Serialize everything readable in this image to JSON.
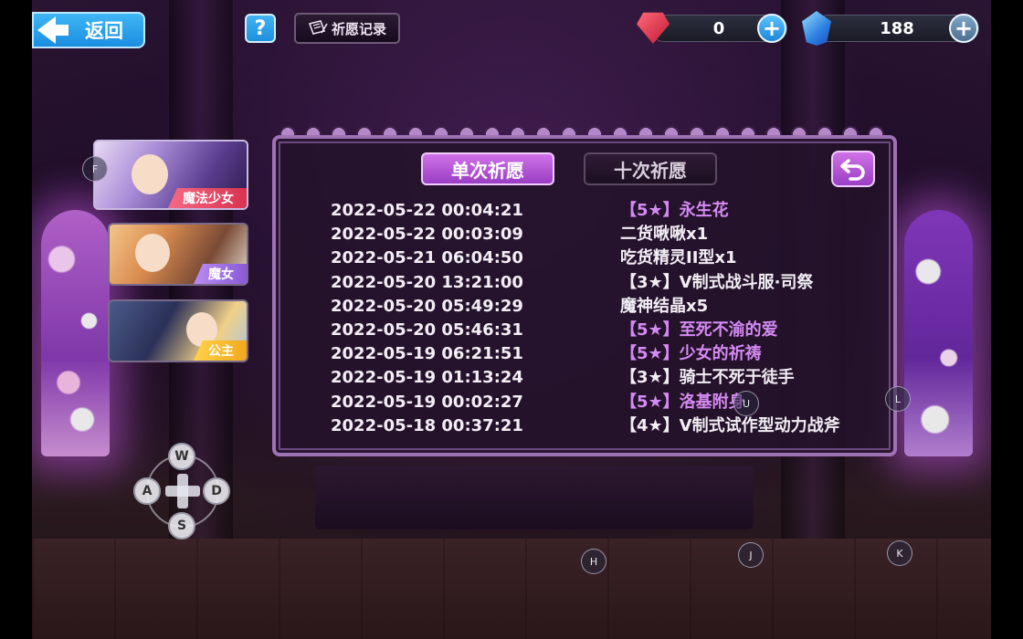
{
  "header": {
    "back_label": "返回",
    "help_label": "?",
    "record_label": "祈愿记录"
  },
  "currency": {
    "red_gem_amount": "0",
    "blue_crystal_amount": "188",
    "plus_label": "+"
  },
  "banners": [
    {
      "label": "魔法少女",
      "color": "#e43f5c"
    },
    {
      "label": "魔女",
      "color": "#a372e6"
    },
    {
      "label": "公主",
      "color": "#f5b82e"
    }
  ],
  "panel": {
    "tab_single": "单次祈愿",
    "tab_ten": "十次祈愿",
    "accent_color": "#d58af2",
    "records": [
      {
        "time": "2022-05-22 00:04:21",
        "item": "【5★】永生花",
        "rare": true
      },
      {
        "time": "2022-05-22 00:03:09",
        "item": "二货啾啾x1",
        "rare": false
      },
      {
        "time": "2022-05-21 06:04:50",
        "item": "吃货精灵II型x1",
        "rare": false
      },
      {
        "time": "2022-05-20 13:21:00",
        "item": "【3★】V制式战斗服·司祭",
        "rare": false
      },
      {
        "time": "2022-05-20 05:49:29",
        "item": "魔神结晶x5",
        "rare": false
      },
      {
        "time": "2022-05-20 05:46:31",
        "item": "【5★】至死不渝的爱",
        "rare": true
      },
      {
        "time": "2022-05-19 06:21:51",
        "item": "【5★】少女的祈祷",
        "rare": true
      },
      {
        "time": "2022-05-19 01:13:24",
        "item": "【3★】骑士不死于徒手",
        "rare": false
      },
      {
        "time": "2022-05-19 00:02:27",
        "item": "【5★】洛基附身",
        "rare": true
      },
      {
        "time": "2022-05-18 00:37:21",
        "item": "【4★】V制式试作型动力战斧",
        "rare": false
      }
    ]
  },
  "keys": {
    "f": "F",
    "u": "U",
    "l": "L",
    "h": "H",
    "j": "J",
    "k": "K",
    "w": "W",
    "a": "A",
    "s": "S",
    "d": "D"
  }
}
